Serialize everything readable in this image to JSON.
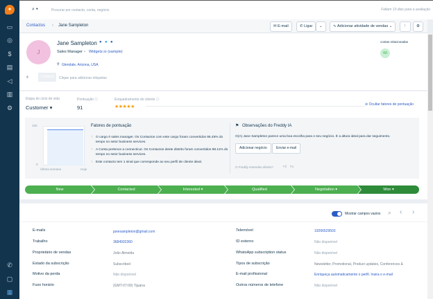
{
  "sidebar": {
    "items": [
      "logo-icon",
      "calendar-icon",
      "contacts-icon",
      "deals-icon",
      "chat-icon",
      "campaigns-icon",
      "reports-icon",
      "settings-icon",
      "phone-icon",
      "help-icon",
      "apps-icon"
    ]
  },
  "topbar": {
    "search_placeholder": "Procurar por contacto, conta, negócio",
    "trial": "Faltam 10 dias para a avaliação"
  },
  "breadcrumb": {
    "root": "Contactos",
    "current": "Jane Sampleton"
  },
  "actions": {
    "email": "E-mail",
    "call": "Ligar",
    "add_activity": "Adicionar atividade de vendas"
  },
  "profile": {
    "initial": "J",
    "name": "Jane Sampleton",
    "title": "Sales Manager",
    "company": "Widgetz.io (sample)",
    "location": "Glendale, Arizona, USA",
    "tag": "Contacto",
    "tag_hint": "Clique para adicionar etiquetas",
    "related_label": "contas relacionadas",
    "related_initials": "Wi"
  },
  "lifecycle": {
    "stage_label": "Etapa do ciclo de vida",
    "stage": "Customer",
    "score_label": "Pontuação",
    "score": "91",
    "fit_label": "Enquadramento do cliente",
    "stars": 5,
    "hide_factors": "Ocultar fatores de pontuação"
  },
  "score_chart": {
    "y_max": "100",
    "y_min": "0",
    "x_start": "Última semana",
    "x_end": "Hoje"
  },
  "factors": {
    "title": "Fatores de pontuação",
    "items": [
      "O cargo é sales manager. Os Contactos com este cargo foram convertidos 95.45% do tempo no setor business services.",
      "A Conta pertence a connecticut. Os Contactos deste distrito foram convertidos 88.11% do tempo no setor business services.",
      "Este contacto tem 1 sinal que corresponde ao seu perfil de cliente ideal."
    ]
  },
  "freddy": {
    "title": "Observações do Freddy IA",
    "text": "O(A) Jane Sampleton parece uma boa escolha para o seu negócio. É a altura ideal para dar seguimento.",
    "add_deal": "Adicionar negócio",
    "send_email": "Enviar e-mail",
    "feedback": "O Freddy entendeu direito?"
  },
  "pipeline": {
    "stages": [
      "New",
      "Contacted",
      "Interested ▾",
      "Qualified",
      "Negotiation ▾",
      "Won ▾"
    ],
    "current": "Won"
  },
  "fields_toolbar": {
    "toggle_label": "Mostrar campos vazios",
    "toggle_on": true
  },
  "fields": {
    "left": [
      [
        "E-mails",
        "janesampleton@gmail.com"
      ],
      [
        "Trabalho",
        "3684932360"
      ],
      [
        "Proprietário de vendas",
        "João Almeida"
      ],
      [
        "Estado da subscrição",
        "Subscribed"
      ],
      [
        "Motivo da perda",
        "Não disponível"
      ],
      [
        "Fuso horário",
        "(GMT-07:00) Tijuana"
      ]
    ],
    "right": [
      [
        "Telemóvel",
        "19266529503"
      ],
      [
        "ID externo",
        "Não disponível"
      ],
      [
        "WhatsApp subscription status",
        "Não disponível"
      ],
      [
        "Tipos de subscrição",
        "Newsletter, Promotional, Product updates, Conferences &"
      ],
      [
        "E-mail profissional",
        "Enriqueça automaticamente o perfil. Insira o e-mail"
      ],
      [
        "Outros números de telefone",
        "Não disponível"
      ]
    ]
  },
  "colors": {
    "sidebar": "#12344d",
    "accent": "#2c5cc5",
    "pipeline": "#4caf50",
    "pipeline_current": "#2e8b3a",
    "avatar": "#f2c1df"
  }
}
